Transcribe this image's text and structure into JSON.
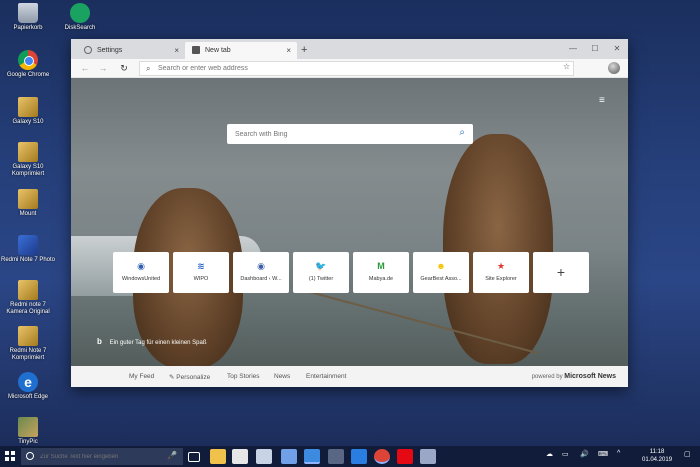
{
  "desktop": {
    "icons": [
      {
        "label": "Papierkorb"
      },
      {
        "label": "DiskSearch"
      },
      {
        "label": "Google Chrome"
      },
      {
        "label": "Galaxy S10"
      },
      {
        "label": "Galaxy S10 Komprimiert"
      },
      {
        "label": "Mount"
      },
      {
        "label": "Redmi Note 7 Photo"
      },
      {
        "label": "Redmi note 7 Kamera Original"
      },
      {
        "label": "Redmi Note 7 Komprimiert"
      },
      {
        "label": "Microsoft Edge"
      },
      {
        "label": "TinyPic"
      }
    ]
  },
  "browser": {
    "tabs": [
      {
        "label": "Settings",
        "active": false
      },
      {
        "label": "New tab",
        "active": true
      }
    ],
    "new_tab_button": "+",
    "close_glyph": "×",
    "window_controls": {
      "minimize": "—",
      "maximize": "☐",
      "close": "✕"
    },
    "nav": {
      "back": "←",
      "forward": "→",
      "refresh": "↻"
    },
    "address_placeholder": "Search or enter web address",
    "favorite_glyph": "☆"
  },
  "newtab": {
    "menu_glyph": "≡",
    "search_placeholder": "Search with Bing",
    "search_glyph": "⌕",
    "tiles": [
      {
        "label": "WindowsUnited",
        "glyph": "◉",
        "color": "#2f5fb0"
      },
      {
        "label": "WIPO",
        "glyph": "≋",
        "color": "#2a62c9"
      },
      {
        "label": "Dashboard ‹ W...",
        "glyph": "◉",
        "color": "#3a5ea8"
      },
      {
        "label": "(1) Twitter",
        "glyph": "🐦",
        "color": "#1da1f2"
      },
      {
        "label": "Mabya.de",
        "glyph": "M",
        "color": "#2b9a3c"
      },
      {
        "label": "GearBest Asso...",
        "glyph": "☻",
        "color": "#f2c500"
      },
      {
        "label": "Site Explorer",
        "glyph": "★",
        "color": "#e2352b"
      }
    ],
    "add_tile": "+",
    "tagline_brand": "b",
    "tagline": "Ein guter Tag für einen kleinen Spaß",
    "feed": {
      "items": [
        "My Feed",
        "✎ Personalize",
        "Top Stories",
        "News",
        "Entertainment"
      ],
      "powered_prefix": "powered by",
      "powered_brand": "Microsoft News"
    }
  },
  "taskbar": {
    "search_placeholder": "Zur Suche Text hier eingeben",
    "mic_glyph": "🎤",
    "time": "11:18",
    "date": "01.04.2019",
    "apps": [
      {
        "name": "task-view",
        "color": "#ffffff"
      },
      {
        "name": "file-explorer",
        "color": "#f0c14b"
      },
      {
        "name": "store",
        "color": "#ffffff"
      },
      {
        "name": "mail",
        "color": "#ffffff"
      },
      {
        "name": "people",
        "color": "#6fa0e8"
      },
      {
        "name": "edge",
        "color": "#3c8be0"
      },
      {
        "name": "terminal",
        "color": "#8a96b0"
      },
      {
        "name": "teamviewer",
        "color": "#2a7de1"
      },
      {
        "name": "chrome",
        "color": "#db4437"
      },
      {
        "name": "netflix",
        "color": "#e50914"
      },
      {
        "name": "snip",
        "color": "#9aa7c7"
      }
    ]
  }
}
